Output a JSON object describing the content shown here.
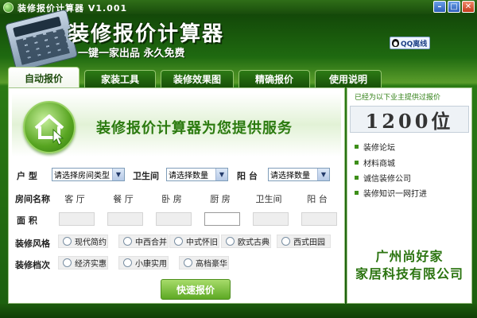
{
  "titlebar": {
    "title": "装修报价计算器   V1.001"
  },
  "header": {
    "logo_title": "装修报价计算器",
    "logo_subtitle": "一键一家出品 永久免费",
    "qq_label": "QQ离线"
  },
  "tabs": [
    {
      "label": "自动报价",
      "active": true
    },
    {
      "label": "家装工具"
    },
    {
      "label": "装修效果图"
    },
    {
      "label": "精确报价"
    },
    {
      "label": "使用说明"
    }
  ],
  "banner": {
    "text": "装修报价计算器为您提供服务"
  },
  "form": {
    "house_type_label": "户  型",
    "house_type_value": "请选择房间类型",
    "bathroom_label": "卫生间",
    "bathroom_value": "请选择数量",
    "balcony_label": "阳  台",
    "balcony_value": "请选择数量",
    "room_name_label": "房间名称",
    "rooms": [
      "客 厅",
      "餐 厅",
      "卧 房",
      "厨 房",
      "卫生间",
      "阳 台"
    ],
    "area_label": "面  积",
    "area_values": [
      "",
      "",
      "",
      "",
      "",
      ""
    ],
    "style_label": "装修风格",
    "styles": [
      "现代简约",
      "中西合并",
      "中式怀旧",
      "欧式古典",
      "西式田园"
    ],
    "grade_label": "装修档次",
    "grades": [
      "经济实惠",
      "小康实用",
      "高档豪华"
    ],
    "quote_button": "快速报价"
  },
  "side": {
    "header": "已经为以下业主提供过报价",
    "counter": "1200位",
    "links": [
      "装修论坛",
      "材料商城",
      "诚信装修公司",
      "装修知识一网打进"
    ],
    "company_line1": "广州尚好家",
    "company_line2": "家居科技有限公司"
  },
  "colors": {
    "brand_green": "#2b7a0f",
    "title_bar": "#184b0b"
  }
}
